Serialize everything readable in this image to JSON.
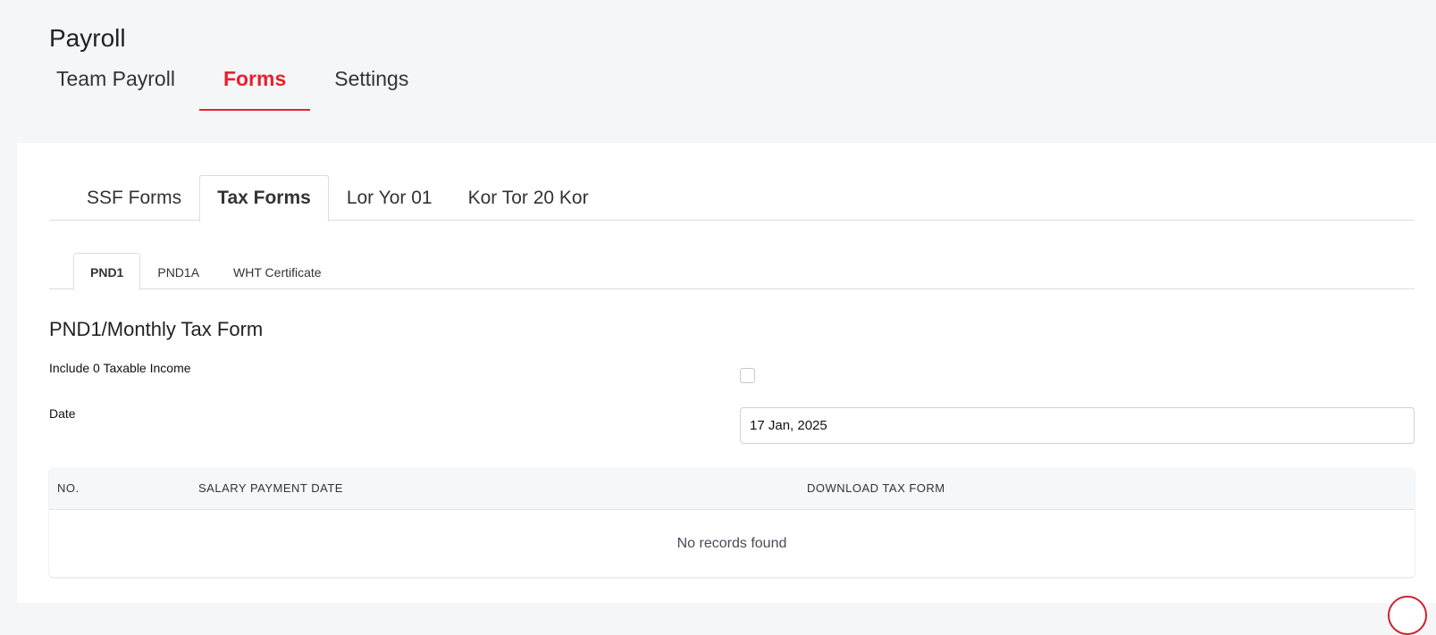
{
  "header": {
    "title": "Payroll"
  },
  "top_tabs": [
    {
      "label": "Team Payroll",
      "active": false
    },
    {
      "label": "Forms",
      "active": true
    },
    {
      "label": "Settings",
      "active": false
    }
  ],
  "form_tabs": [
    {
      "label": "SSF Forms",
      "active": false
    },
    {
      "label": "Tax Forms",
      "active": true
    },
    {
      "label": "Lor Yor 01",
      "active": false
    },
    {
      "label": "Kor Tor 20 Kor",
      "active": false
    }
  ],
  "sub_tabs": [
    {
      "label": "PND1",
      "active": true
    },
    {
      "label": "PND1A",
      "active": false
    },
    {
      "label": "WHT Certificate",
      "active": false
    }
  ],
  "section": {
    "heading": "PND1/Monthly Tax Form",
    "include_zero_label": "Include 0 Taxable Income",
    "include_zero_checked": false,
    "date_label": "Date",
    "date_value": "17 Jan, 2025"
  },
  "table": {
    "columns": [
      "NO.",
      "SALARY PAYMENT DATE",
      "DOWNLOAD TAX FORM"
    ],
    "empty_text": "No records found"
  },
  "colors": {
    "accent": "#e8212f",
    "page_bg": "#f5f6f8"
  }
}
